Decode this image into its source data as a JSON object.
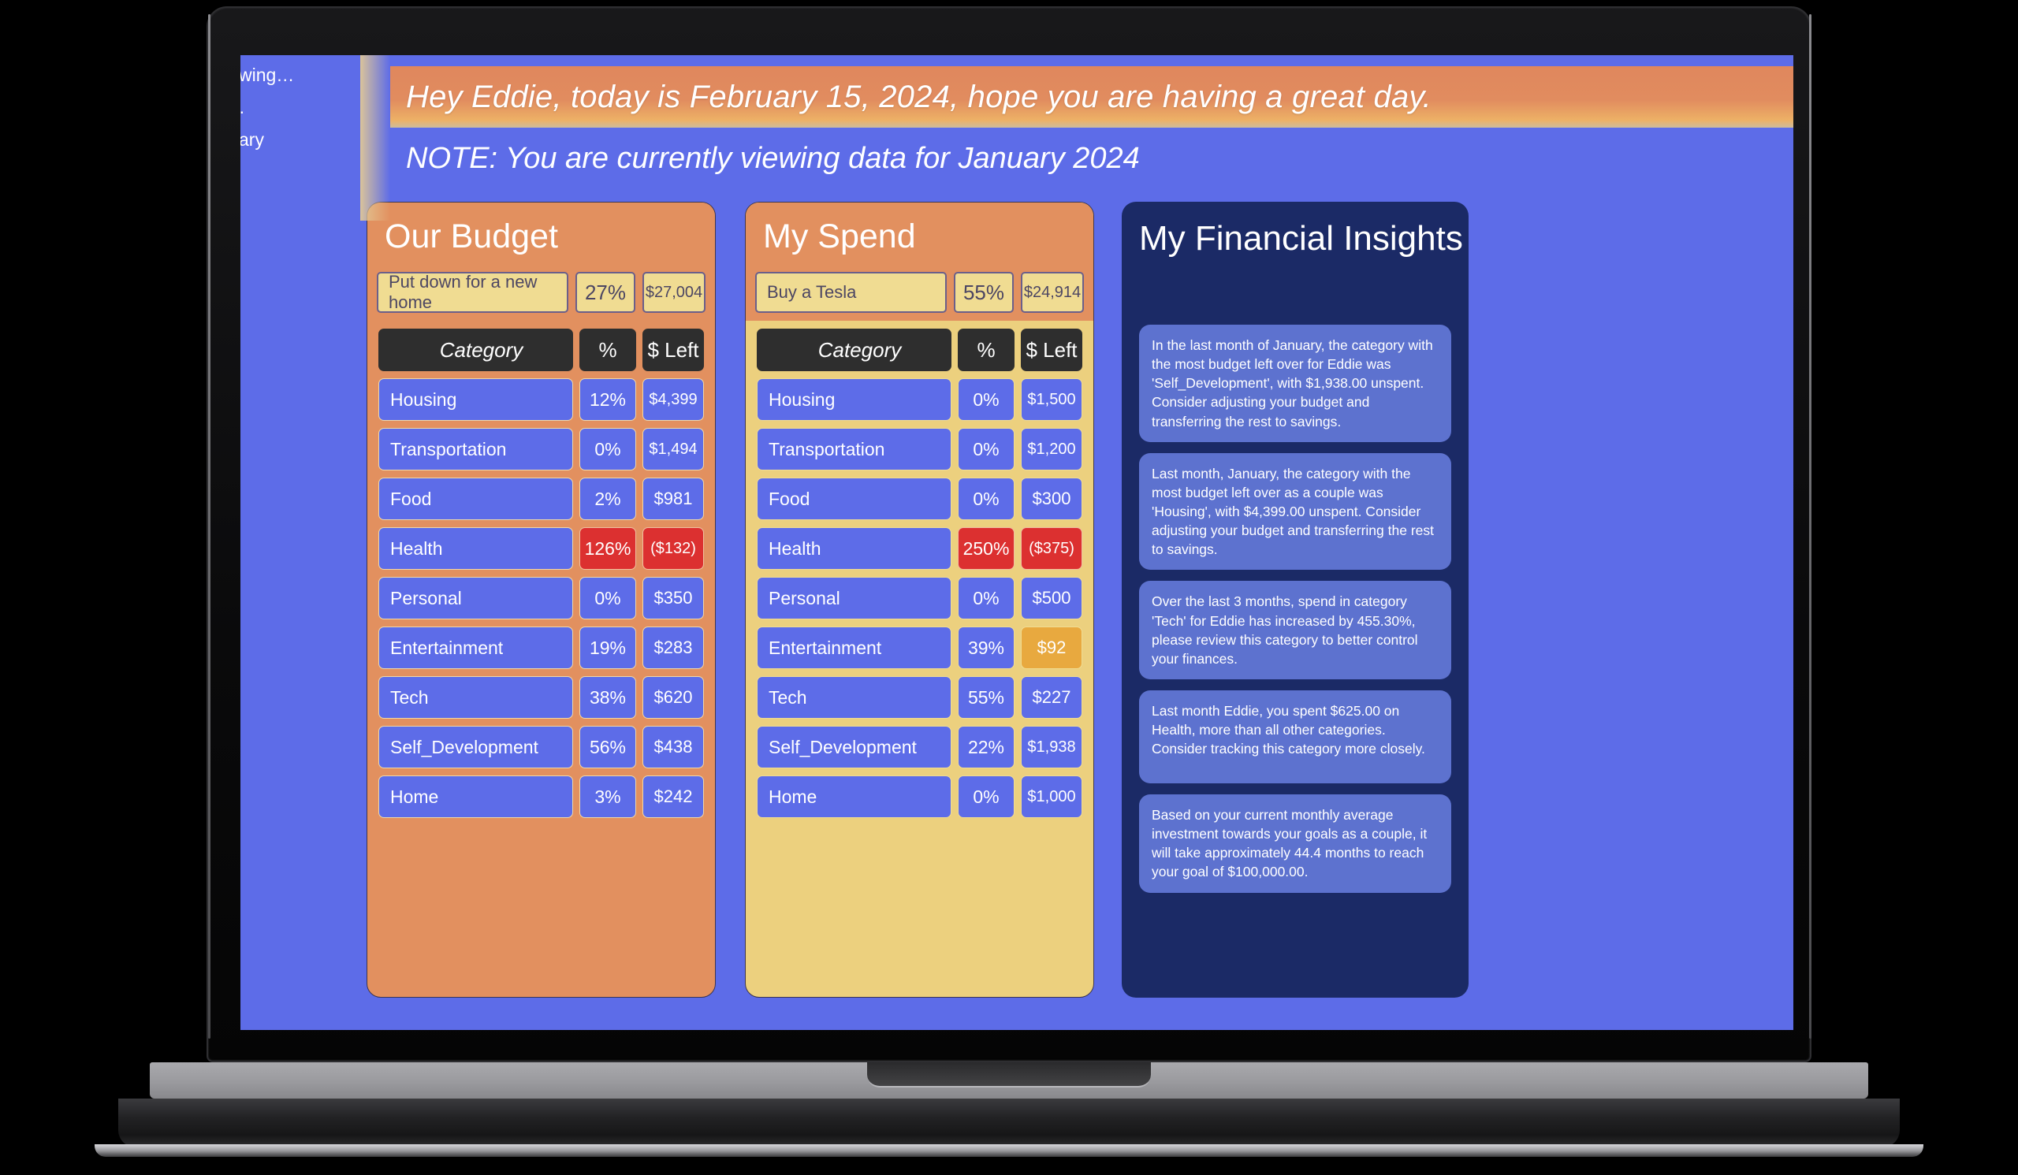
{
  "app": {
    "background_color": "#5d6ce8",
    "accent_orange": "#e2905f",
    "accent_yellow": "#ecd07e",
    "negative_color": "#dc3030",
    "warn_color": "#e8a93f",
    "insights_bg": "#1b2a66"
  },
  "sidebar": {
    "items": [
      {
        "label": "wing…"
      },
      {
        "label": "·"
      },
      {
        "label": "ary"
      }
    ]
  },
  "header": {
    "greeting": "Hey Eddie, today is February 15, 2024, hope you are having a great day.",
    "note": "NOTE: You are currently viewing data for January 2024"
  },
  "avatars": [
    {
      "name": "astronaut-avatar-active",
      "state": "active"
    },
    {
      "name": "astronaut-avatar-inactive",
      "state": "inactive"
    }
  ],
  "budget_card": {
    "title": "Our Budget",
    "goal_name": "Put down for a new home",
    "goal_percent": "27%",
    "goal_amount": "$27,004",
    "columns": [
      "Category",
      "%",
      "$ Left"
    ],
    "rows": [
      {
        "category": "Housing",
        "percent": "12%",
        "left": "$4,399",
        "status": "ok"
      },
      {
        "category": "Transportation",
        "percent": "0%",
        "left": "$1,494",
        "status": "ok"
      },
      {
        "category": "Food",
        "percent": "2%",
        "left": "$981",
        "status": "ok"
      },
      {
        "category": "Health",
        "percent": "126%",
        "left": "($132)",
        "status": "negative"
      },
      {
        "category": "Personal",
        "percent": "0%",
        "left": "$350",
        "status": "ok"
      },
      {
        "category": "Entertainment",
        "percent": "19%",
        "left": "$283",
        "status": "ok"
      },
      {
        "category": "Tech",
        "percent": "38%",
        "left": "$620",
        "status": "ok"
      },
      {
        "category": "Self_Development",
        "percent": "56%",
        "left": "$438",
        "status": "ok"
      },
      {
        "category": "Home",
        "percent": "3%",
        "left": "$242",
        "status": "ok"
      }
    ]
  },
  "spend_card": {
    "title": "My Spend",
    "goal_name": "Buy a Tesla",
    "goal_percent": "55%",
    "goal_amount": "$24,914",
    "columns": [
      "Category",
      "%",
      "$ Left"
    ],
    "rows": [
      {
        "category": "Housing",
        "percent": "0%",
        "left": "$1,500",
        "status": "ok"
      },
      {
        "category": "Transportation",
        "percent": "0%",
        "left": "$1,200",
        "status": "ok"
      },
      {
        "category": "Food",
        "percent": "0%",
        "left": "$300",
        "status": "ok"
      },
      {
        "category": "Health",
        "percent": "250%",
        "left": "($375)",
        "status": "negative"
      },
      {
        "category": "Personal",
        "percent": "0%",
        "left": "$500",
        "status": "ok"
      },
      {
        "category": "Entertainment",
        "percent": "39%",
        "left": "$92",
        "status": "warn"
      },
      {
        "category": "Tech",
        "percent": "55%",
        "left": "$227",
        "status": "ok"
      },
      {
        "category": "Self_Development",
        "percent": "22%",
        "left": "$1,938",
        "status": "ok"
      },
      {
        "category": "Home",
        "percent": "0%",
        "left": "$1,000",
        "status": "ok"
      }
    ]
  },
  "insights_card": {
    "title": "My Financial Insights",
    "items": [
      "In the last month of January, the category with the most budget left over for Eddie was 'Self_Development', with $1,938.00 unspent. Consider adjusting your budget and transferring the rest to savings.",
      "Last month, January, the category with the most budget left over as a couple was 'Housing', with $4,399.00 unspent. Consider adjusting your budget and transferring the rest to savings.",
      "Over the last 3 months, spend in category 'Tech' for Eddie has increased by 455.30%, please review this category to better control your finances.",
      "Last month Eddie, you spent $625.00 on Health, more than all other categories. Consider tracking this category more closely.",
      "Based on your current monthly average investment towards your goals as a couple, it will take approximately 44.4 months to reach your goal of $100,000.00."
    ]
  }
}
